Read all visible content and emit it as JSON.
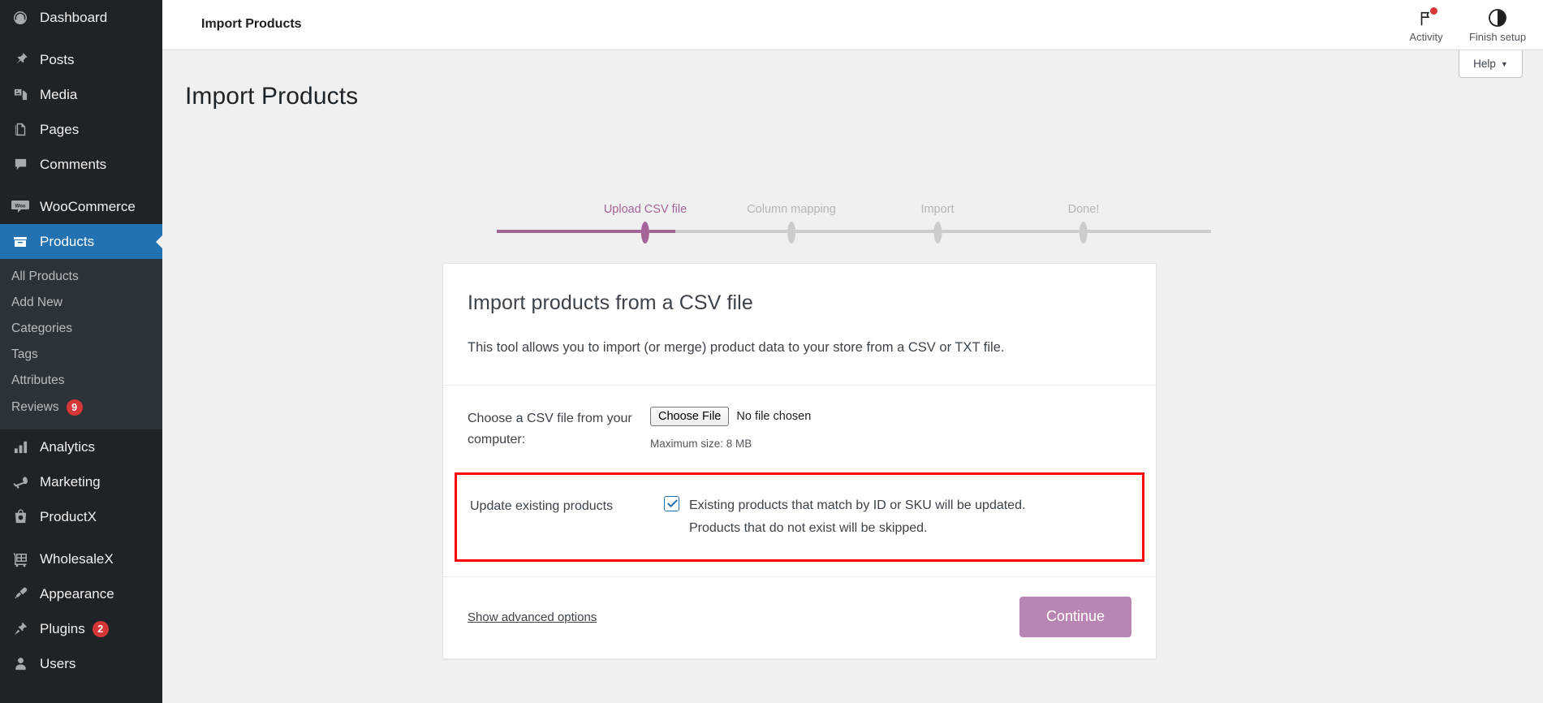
{
  "sidebar": {
    "items": [
      {
        "label": "Dashboard",
        "icon": "dashboard-icon",
        "name": "dashboard"
      },
      {
        "label": "Posts",
        "icon": "pin-icon",
        "name": "posts"
      },
      {
        "label": "Media",
        "icon": "media-icon",
        "name": "media"
      },
      {
        "label": "Pages",
        "icon": "pages-icon",
        "name": "pages"
      },
      {
        "label": "Comments",
        "icon": "comment-icon",
        "name": "comments"
      },
      {
        "label": "WooCommerce",
        "icon": "woo-icon",
        "name": "woocommerce"
      },
      {
        "label": "Products",
        "icon": "products-icon",
        "name": "products",
        "current": true
      },
      {
        "label": "Analytics",
        "icon": "chart-bars-icon",
        "name": "analytics"
      },
      {
        "label": "Marketing",
        "icon": "megaphone-icon",
        "name": "marketing"
      },
      {
        "label": "ProductX",
        "icon": "bag-icon",
        "name": "productx"
      },
      {
        "label": "WholesaleX",
        "icon": "cart-grid-icon",
        "name": "wholesalex"
      },
      {
        "label": "Appearance",
        "icon": "paintbrush-icon",
        "name": "appearance"
      },
      {
        "label": "Plugins",
        "icon": "plug-icon",
        "name": "plugins",
        "badge": "2"
      },
      {
        "label": "Users",
        "icon": "user-icon",
        "name": "users"
      }
    ],
    "submenu": [
      {
        "label": "All Products",
        "name": "all-products"
      },
      {
        "label": "Add New",
        "name": "add-new"
      },
      {
        "label": "Categories",
        "name": "categories"
      },
      {
        "label": "Tags",
        "name": "tags"
      },
      {
        "label": "Attributes",
        "name": "attributes"
      },
      {
        "label": "Reviews",
        "name": "reviews",
        "badge": "9"
      }
    ]
  },
  "topbar": {
    "title": "Import Products",
    "activity_label": "Activity",
    "finish_setup_label": "Finish setup",
    "help_label": "Help",
    "help_caret": "▼"
  },
  "page": {
    "title": "Import Products"
  },
  "steps": [
    {
      "label": "Upload CSV file",
      "state": "done"
    },
    {
      "label": "Column mapping",
      "state": "todo"
    },
    {
      "label": "Import",
      "state": "todo"
    },
    {
      "label": "Done!",
      "state": "todo"
    }
  ],
  "card": {
    "heading": "Import products from a CSV file",
    "description": "This tool allows you to import (or merge) product data to your store from a CSV or TXT file.",
    "file_row": {
      "label": "Choose a CSV file from your computer:",
      "button_label": "Choose File",
      "file_status": "No file chosen",
      "max_size": "Maximum size: 8 MB"
    },
    "update_row": {
      "label": "Update existing products",
      "checkbox_checked": true,
      "description_line1": "Existing products that match by ID or SKU will be updated.",
      "description_line2": "Products that do not exist will be skipped."
    },
    "footer": {
      "advanced_link": "Show advanced options",
      "continue_label": "Continue"
    }
  },
  "colors": {
    "accent_purple": "#a46497",
    "button_purple": "#b986b3",
    "sidebar_bg": "#1d2327",
    "submenu_bg": "#2c3338",
    "current_menu_bg": "#2271b1",
    "badge_red": "#d63638",
    "highlight_red": "#fe0000",
    "checkbox_blue": "#2271b1"
  }
}
